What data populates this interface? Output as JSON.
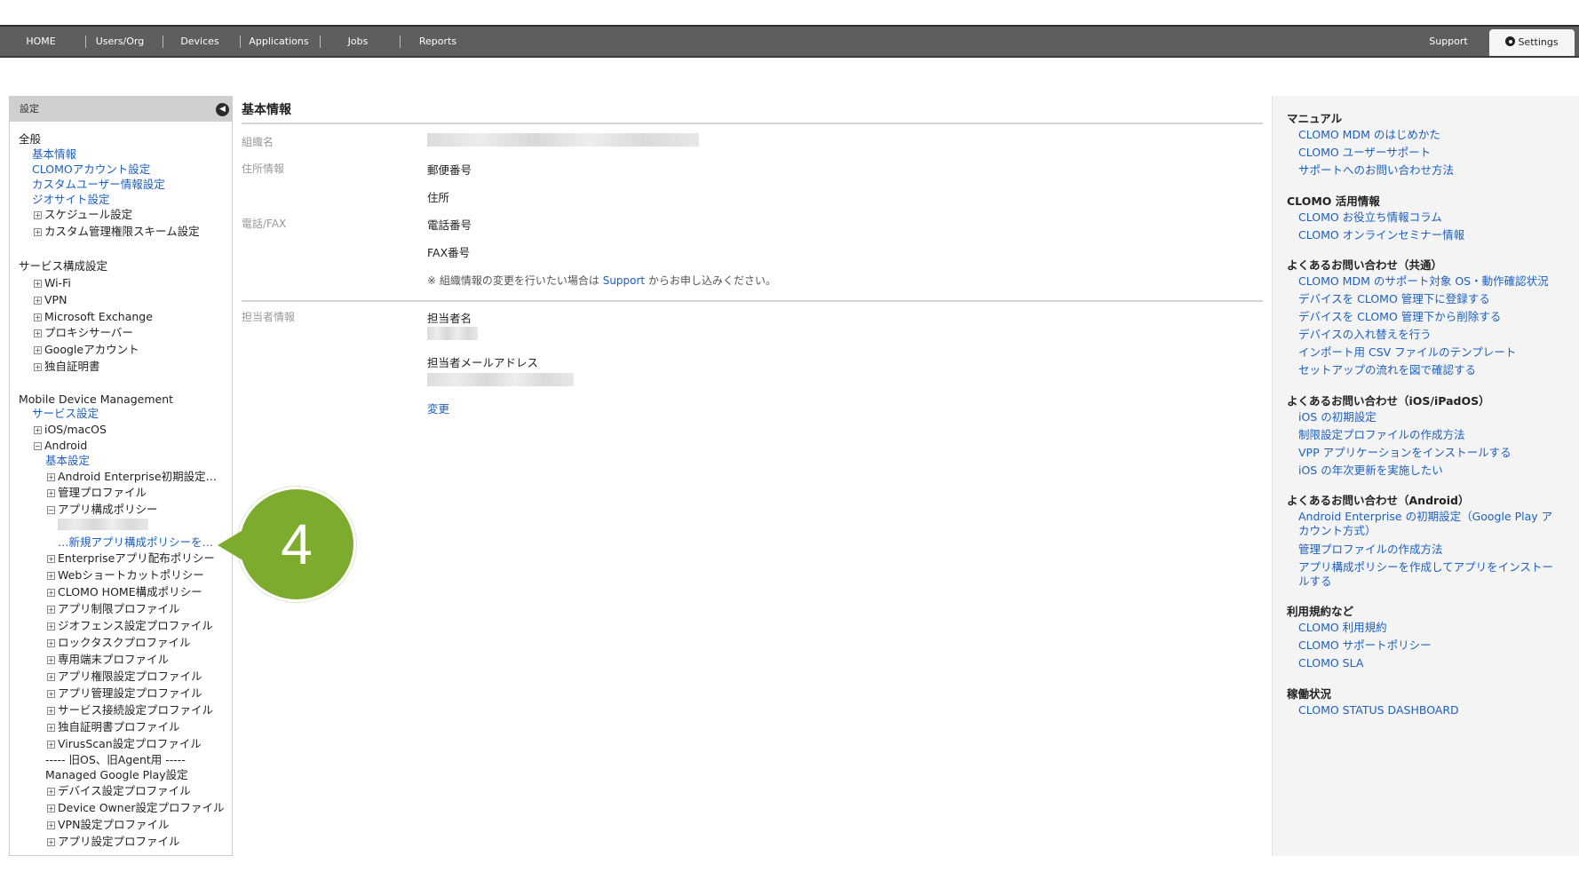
{
  "nav": {
    "items": [
      "HOME",
      "Users/Org",
      "Devices",
      "Applications",
      "Jobs",
      "Reports"
    ],
    "support": "Support",
    "settings": "Settings"
  },
  "sidebar": {
    "header": "設定",
    "general_title": "全般",
    "general": [
      "基本情報",
      "CLOMOアカウント設定",
      "カスタムユーザー情報設定",
      "ジオサイト設定"
    ],
    "general_expand": [
      "スケジュール設定",
      "カスタム管理権限スキーム設定"
    ],
    "service_title": "サービス構成設定",
    "service": [
      "Wi-Fi",
      "VPN",
      "Microsoft Exchange",
      "プロキシサーバー",
      "Googleアカウント",
      "独自証明書"
    ],
    "mdm_title": "Mobile Device Management",
    "mdm_service": "サービス設定",
    "ios": "iOS/macOS",
    "android": "Android",
    "android_basic": "基本設定",
    "android_items_a": [
      "Android Enterprise初期設定…",
      "管理プロファイル"
    ],
    "app_policy": "アプリ構成ポリシー",
    "new_policy": "…新規アプリ構成ポリシーを…",
    "android_items_b": [
      "Enterpriseアプリ配布ポリシー",
      "Webショートカットポリシー",
      "CLOMO HOME構成ポリシー",
      "アプリ制限プロファイル",
      "ジオフェンス設定プロファイル",
      "ロックタスクプロファイル",
      "専用端末プロファイル",
      "アプリ権限設定プロファイル",
      "アプリ管理設定プロファイル",
      "サービス接続設定プロファイル",
      "独自証明書プロファイル",
      "VirusScan設定プロファイル"
    ],
    "old_os": "----- 旧OS、旧Agent用 -----",
    "managed_gp": "Managed Google Play設定",
    "android_items_c": [
      "デバイス設定プロファイル",
      "Device Owner設定プロファイル",
      "VPN設定プロファイル",
      "アプリ設定プロファイル"
    ]
  },
  "main": {
    "title": "基本情報",
    "org_label": "組織名",
    "address_label": "住所情報",
    "postal": "郵便番号",
    "address": "住所",
    "phone_label": "電話/FAX",
    "phone": "電話番号",
    "fax": "FAX番号",
    "note_pre": "※ 組織情報の変更を行いたい場合は",
    "note_link": "Support",
    "note_post": "からお申し込みください。",
    "contact_label": "担当者情報",
    "contact_name": "担当者名",
    "contact_mail": "担当者メールアドレス",
    "change": "変更"
  },
  "right": {
    "manual_title": "マニュアル",
    "manual": [
      "CLOMO MDM のはじめかた",
      "CLOMO ユーザーサポート",
      "サポートへのお問い合わせ方法"
    ],
    "util_title": "CLOMO 活用情報",
    "util": [
      "CLOMO お役立ち情報コラム",
      "CLOMO オンラインセミナー情報"
    ],
    "faq_common_title": "よくあるお問い合わせ（共通）",
    "faq_common": [
      "CLOMO MDM のサポート対象 OS・動作確認状況",
      "デバイスを CLOMO 管理下に登録する",
      "デバイスを CLOMO 管理下から削除する",
      "デバイスの入れ替えを行う",
      "インポート用 CSV ファイルのテンプレート",
      "セットアップの流れを図で確認する"
    ],
    "faq_ios_title": "よくあるお問い合わせ（iOS/iPadOS）",
    "faq_ios": [
      "iOS の初期設定",
      "制限設定プロファイルの作成方法",
      "VPP アプリケーションをインストールする",
      "iOS の年次更新を実施したい"
    ],
    "faq_android_title": "よくあるお問い合わせ（Android）",
    "faq_android": [
      "Android Enterprise の初期設定（Google Play アカウント方式）",
      "管理プロファイルの作成方法",
      "アプリ構成ポリシーを作成してアプリをインストールする"
    ],
    "terms_title": "利用規約など",
    "terms": [
      "CLOMO 利用規約",
      "CLOMO サポートポリシー",
      "CLOMO SLA"
    ],
    "status_title": "稼働状況",
    "status": [
      "CLOMO STATUS DASHBOARD"
    ]
  },
  "callout": {
    "number": "4",
    "color": "#7dab2e"
  }
}
